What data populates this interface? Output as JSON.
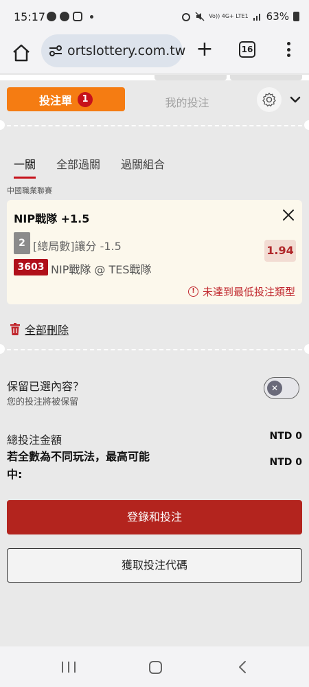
{
  "status_bar": {
    "time": "15:17",
    "network": "Vo)) 4G+ LTE1",
    "battery": "63%"
  },
  "browser": {
    "url": "ortslottery.com.tw",
    "tab_count": "16"
  },
  "betslip": {
    "tab_slip_label": "投注單",
    "slip_count": "1",
    "tab_mybets_label": "我的投注",
    "subtabs": [
      "一關",
      "全部過關",
      "過關組合"
    ],
    "league": "中國職業聯賽",
    "selection": {
      "name": "NIP戰隊 +1.5",
      "market_num": "2",
      "market_text": "[總局數]讓分 -1.5",
      "odds": "1.94",
      "event_code": "3603",
      "event_text": "NIP戰隊 @ TES戰隊",
      "warning": "未達到最低投注類型"
    },
    "delete_all_label": "全部刪除",
    "retain_title": "保留已選內容？",
    "retain_sub": "您的投注將被保留",
    "total_label": "總投注金額",
    "total_value": "NTD 0",
    "max_win_label": "若全數為不同玩法，最高可能中:",
    "max_win_value": "NTD 0",
    "primary_button": "登錄和投注",
    "secondary_button": "獲取投注代碼"
  },
  "colors": {
    "accent_orange": "#f57c12",
    "brand_red": "#b3241e",
    "warning_red": "#c0272d"
  }
}
